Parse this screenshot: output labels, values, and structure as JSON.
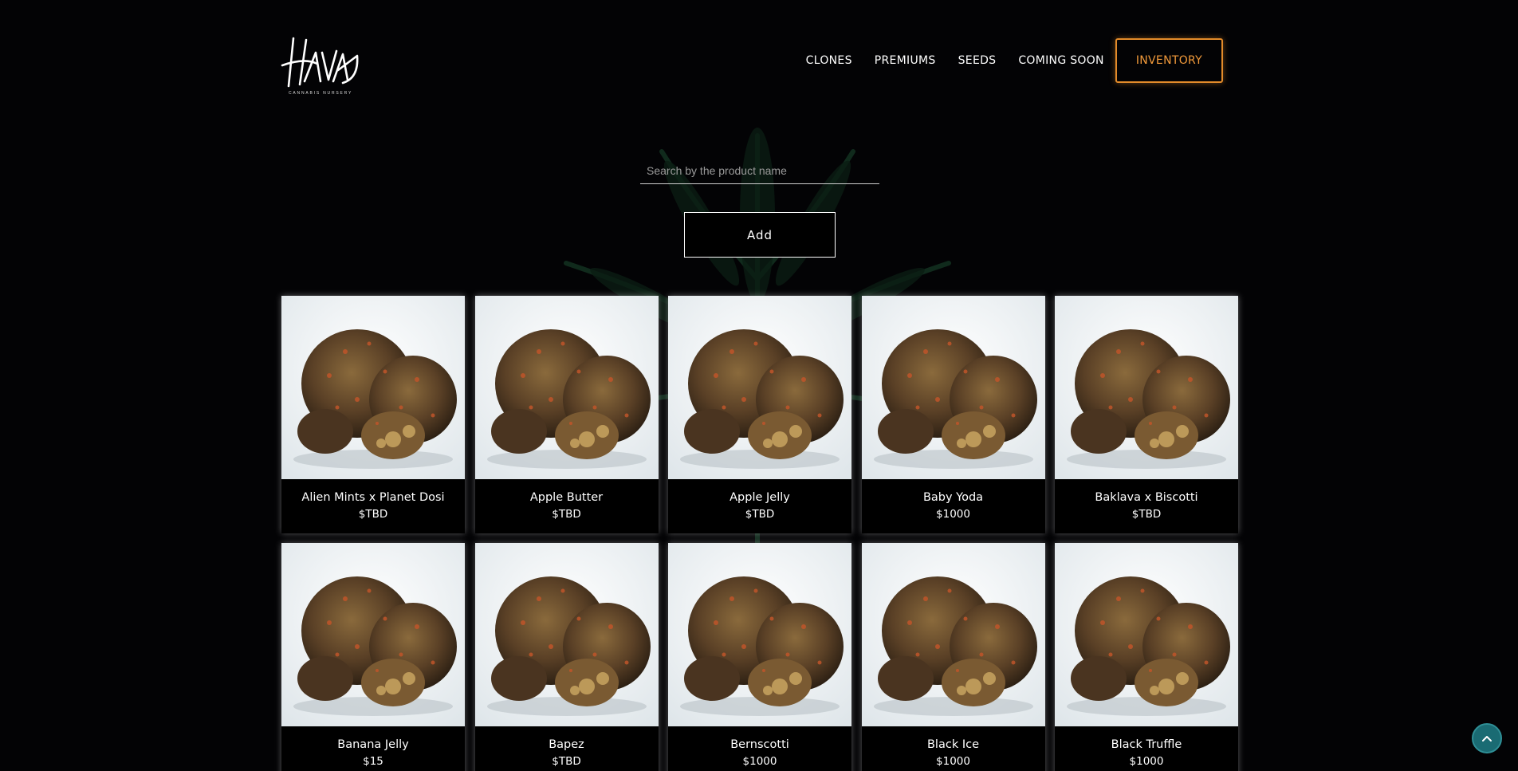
{
  "brand": {
    "logo_text": "HAVA",
    "logo_subtitle": "CANNABIS NURSERY"
  },
  "nav": {
    "items": [
      {
        "label": "CLONES"
      },
      {
        "label": "PREMIUMS"
      },
      {
        "label": "SEEDS"
      },
      {
        "label": "COMING SOON"
      }
    ],
    "inventory_label": "INVENTORY"
  },
  "search": {
    "placeholder": "Search by the product name",
    "value": ""
  },
  "add_button_label": "Add",
  "products": [
    {
      "name": "Alien Mints x Planet Dosi",
      "price": "$TBD"
    },
    {
      "name": "Apple Butter",
      "price": "$TBD"
    },
    {
      "name": "Apple Jelly",
      "price": "$TBD"
    },
    {
      "name": "Baby Yoda",
      "price": "$1000"
    },
    {
      "name": "Baklava x Biscotti",
      "price": "$TBD"
    },
    {
      "name": "Banana Jelly",
      "price": "$15"
    },
    {
      "name": "Bapez",
      "price": "$TBD"
    },
    {
      "name": "Bernscotti",
      "price": "$1000"
    },
    {
      "name": "Black Ice",
      "price": "$1000"
    },
    {
      "name": "Black Truffle",
      "price": "$1000"
    }
  ],
  "icons": {
    "back_to_top": "chevron-up-icon"
  },
  "colors": {
    "accent": "#e38b2a",
    "back_to_top": "#1a6b73",
    "background": "#030305"
  }
}
